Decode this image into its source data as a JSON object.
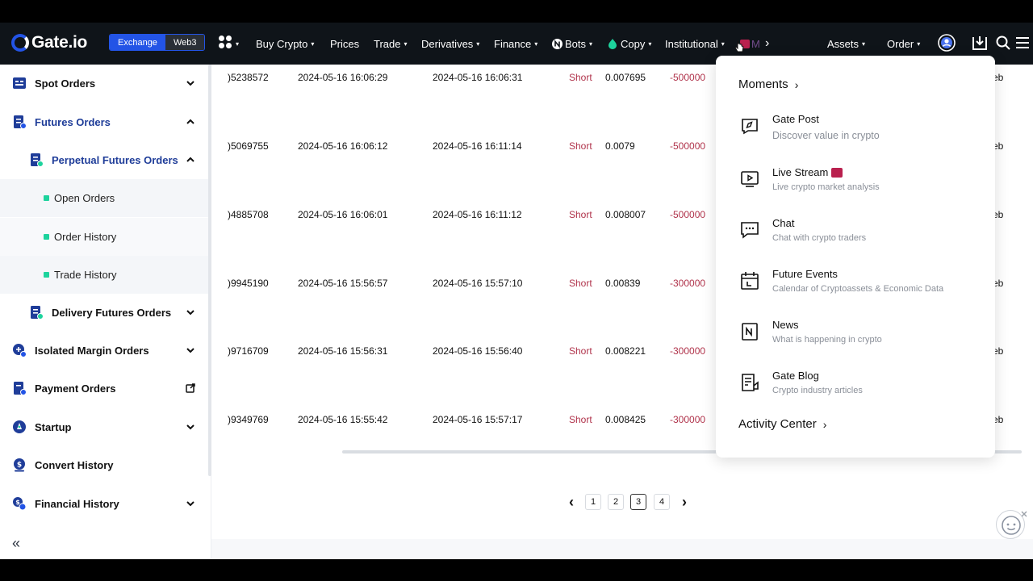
{
  "header": {
    "logo_text": "Gate.io",
    "seg_exchange": "Exchange",
    "seg_web3": "Web3",
    "nav": [
      {
        "label": "Buy Crypto",
        "caret": true
      },
      {
        "label": "Prices",
        "caret": false
      },
      {
        "label": "Trade",
        "caret": true
      },
      {
        "label": "Derivatives",
        "caret": true
      },
      {
        "label": "Finance",
        "caret": true
      },
      {
        "label": "Bots",
        "caret": true
      },
      {
        "label": "Copy",
        "caret": true
      },
      {
        "label": "Institutional",
        "caret": true
      },
      {
        "label": "M",
        "caret": false
      }
    ],
    "assets": "Assets",
    "order": "Order",
    "caret": "▾",
    "more_arrow": "›"
  },
  "sidebar": {
    "items": [
      {
        "label": "Spot Orders"
      },
      {
        "label": "Futures Orders"
      },
      {
        "label": "Perpetual Futures Orders"
      },
      {
        "label": "Open Orders"
      },
      {
        "label": "Order History"
      },
      {
        "label": "Trade History"
      },
      {
        "label": "Delivery Futures Orders"
      },
      {
        "label": "Isolated Margin Orders"
      },
      {
        "label": "Payment Orders"
      },
      {
        "label": "Startup"
      },
      {
        "label": "Convert History"
      },
      {
        "label": "Financial History"
      }
    ],
    "collapse_glyph": "«"
  },
  "table": {
    "rows": [
      {
        "id": ")5238572",
        "created": "2024-05-16 16:06:29",
        "updated": "2024-05-16 16:06:31",
        "side": "Short",
        "price": "0.007695",
        "size": "-500000",
        "tail": "eb"
      },
      {
        "id": ")5069755",
        "created": "2024-05-16 16:06:12",
        "updated": "2024-05-16 16:11:14",
        "side": "Short",
        "price": "0.0079",
        "size": "-500000",
        "tail": "eb"
      },
      {
        "id": ")4885708",
        "created": "2024-05-16 16:06:01",
        "updated": "2024-05-16 16:11:12",
        "side": "Short",
        "price": "0.008007",
        "size": "-500000",
        "tail": "eb"
      },
      {
        "id": ")9945190",
        "created": "2024-05-16 15:56:57",
        "updated": "2024-05-16 15:57:10",
        "side": "Short",
        "price": "0.00839",
        "size": "-300000",
        "tail": "eb"
      },
      {
        "id": ")9716709",
        "created": "2024-05-16 15:56:31",
        "updated": "2024-05-16 15:56:40",
        "side": "Short",
        "price": "0.008221",
        "size": "-300000",
        "tail": "eb"
      },
      {
        "id": ")9349769",
        "created": "2024-05-16 15:55:42",
        "updated": "2024-05-16 15:57:17",
        "side": "Short",
        "price": "0.008425",
        "size": "-300000",
        "tail": "eb"
      }
    ]
  },
  "pagination": {
    "prev": "‹",
    "pages": [
      "1",
      "2",
      "3",
      "4"
    ],
    "current": "3",
    "next": "›"
  },
  "dropdown": {
    "moments": "Moments",
    "activity": "Activity Center",
    "arrow": "›",
    "items": [
      {
        "title": "Gate Post",
        "subtitle": "Discover value in crypto",
        "icon": "compass-chat-icon"
      },
      {
        "title": "Live Stream",
        "subtitle": "Live crypto market analysis",
        "icon": "play-screen-icon"
      },
      {
        "title": "Chat",
        "subtitle": "Chat with crypto traders",
        "icon": "chat-bubble-icon"
      },
      {
        "title": "Future Events",
        "subtitle": "Calendar of Cryptoassets & Economic Data",
        "icon": "calendar-icon"
      },
      {
        "title": "News",
        "subtitle": "What is happening in crypto",
        "icon": "news-icon"
      },
      {
        "title": "Gate Blog",
        "subtitle": "Crypto industry articles",
        "icon": "blog-doc-icon"
      }
    ]
  },
  "colors": {
    "brand": "#2354e6",
    "short": "#b0334b",
    "active_dot": "#1dd39d",
    "live_badge": "#b9204e"
  }
}
